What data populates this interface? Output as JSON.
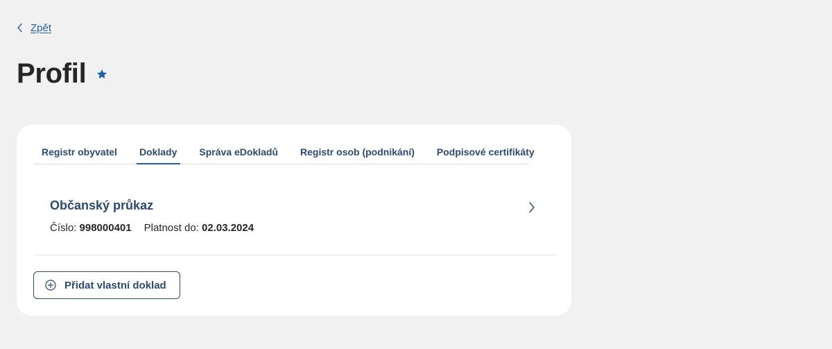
{
  "back_link": {
    "label": "Zpět",
    "icon": "chevron-left-icon"
  },
  "page": {
    "title": "Profil",
    "favorite_icon": "star-icon"
  },
  "tabs": [
    {
      "label": "Registr obyvatel",
      "active": false
    },
    {
      "label": "Doklady",
      "active": true
    },
    {
      "label": "Správa eDokladů",
      "active": false
    },
    {
      "label": "Registr osob (podnikání)",
      "active": false
    },
    {
      "label": "Podpisové certifikáty",
      "active": false
    }
  ],
  "document": {
    "title": "Občanský průkaz",
    "number_label": "Číslo:",
    "number_value": "998000401",
    "validity_label": "Platnost do:",
    "validity_value": "02.03.2024",
    "icon": "chevron-right-icon"
  },
  "add_document": {
    "label": "Přidat vlastní doklad",
    "icon": "plus-circle-icon"
  },
  "colors": {
    "background": "#f1f1f1",
    "card": "#ffffff",
    "primary": "#2b4a71",
    "accent": "#2362a2",
    "text": "#262626"
  }
}
